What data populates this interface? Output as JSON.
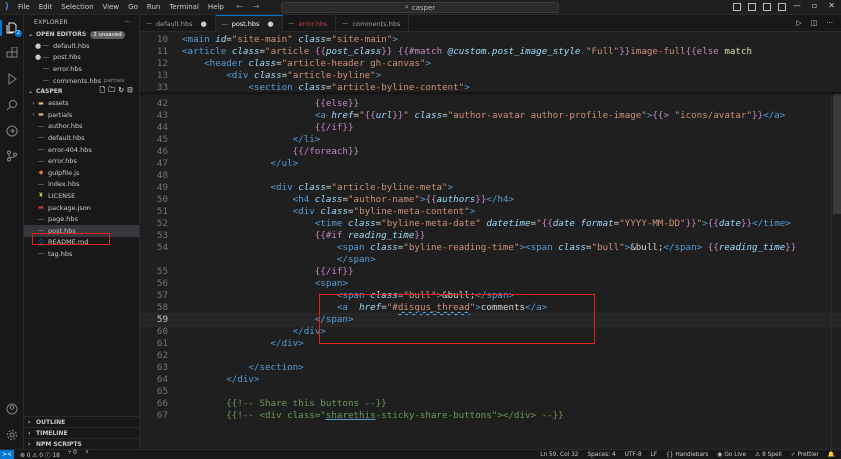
{
  "titlebar": {
    "menu": [
      "File",
      "Edit",
      "Selection",
      "View",
      "Go",
      "Run",
      "Terminal",
      "Help"
    ],
    "search_text": "casper",
    "nav_back": "←",
    "nav_forward": "→"
  },
  "sidebar": {
    "header": "EXPLORER",
    "header_more": "···",
    "open_editors": {
      "title": "OPEN EDITORS",
      "badge": "2 unsaved",
      "items": [
        {
          "name": "default.hbs",
          "dirty": true
        },
        {
          "name": "post.hbs",
          "dirty": true
        },
        {
          "name": "error.hbs",
          "dirty": false
        },
        {
          "name": "comments.hbs",
          "desc": "partials",
          "dirty": false
        }
      ]
    },
    "folder": {
      "title": "CASPER",
      "items": [
        {
          "name": "assets",
          "type": "folder"
        },
        {
          "name": "partials",
          "type": "folder"
        },
        {
          "name": "author.hbs",
          "type": "hbs"
        },
        {
          "name": "default.hbs",
          "type": "hbs"
        },
        {
          "name": "error-404.hbs",
          "type": "hbs"
        },
        {
          "name": "error.hbs",
          "type": "hbs"
        },
        {
          "name": "gulpfile.js",
          "type": "js"
        },
        {
          "name": "index.hbs",
          "type": "hbs"
        },
        {
          "name": "LICENSE",
          "type": "license"
        },
        {
          "name": "package.json",
          "type": "json"
        },
        {
          "name": "page.hbs",
          "type": "hbs"
        },
        {
          "name": "post.hbs",
          "type": "hbs",
          "selected": true
        },
        {
          "name": "README.md",
          "type": "md"
        },
        {
          "name": "tag.hbs",
          "type": "hbs"
        }
      ]
    },
    "bottom_sections": [
      "OUTLINE",
      "TIMELINE",
      "NPM SCRIPTS"
    ]
  },
  "tabs": [
    {
      "label": "default.hbs",
      "dirty": true,
      "state": "normal"
    },
    {
      "label": "post.hbs",
      "dirty": true,
      "state": "active"
    },
    {
      "label": "error.hbs",
      "state": "error"
    },
    {
      "label": "comments.hbs",
      "state": "normal"
    }
  ],
  "editor": {
    "current_line": "59",
    "lines": [
      {
        "n": "10",
        "sticky": true
      },
      {
        "n": "11",
        "sticky": true
      },
      {
        "n": "12",
        "sticky": true
      },
      {
        "n": "13",
        "sticky": true
      },
      {
        "n": "33",
        "sticky": true
      },
      {
        "n": "42"
      },
      {
        "n": "43"
      },
      {
        "n": "44"
      },
      {
        "n": "45"
      },
      {
        "n": "46"
      },
      {
        "n": "47"
      },
      {
        "n": "48"
      },
      {
        "n": "49"
      },
      {
        "n": "50"
      },
      {
        "n": "51"
      },
      {
        "n": "52"
      },
      {
        "n": "53"
      },
      {
        "n": "54"
      },
      {
        "n": ""
      },
      {
        "n": "55"
      },
      {
        "n": "56"
      },
      {
        "n": "57"
      },
      {
        "n": "58"
      },
      {
        "n": "59"
      },
      {
        "n": "60"
      },
      {
        "n": "61"
      },
      {
        "n": "62"
      },
      {
        "n": "63"
      },
      {
        "n": "64"
      },
      {
        "n": "65"
      },
      {
        "n": "66"
      },
      {
        "n": "67"
      }
    ]
  },
  "statusbar": {
    "remote": "><",
    "problems": "⊗ 0 ⚠ 0 ⓘ 18",
    "ports": "⑂ 0",
    "sync": "⚡",
    "position": "Ln 59, Col 32",
    "spaces": "Spaces: 4",
    "encoding": "UTF-8",
    "eol": "LF",
    "language": "{} Handlebars",
    "golive": "Go Live",
    "spell": "⚠ 8 Spell",
    "prettier": "✓ Prettier",
    "bell": "🔔"
  },
  "colors": {
    "accent": "#0078d4",
    "highlight_box": "#e0241b"
  }
}
